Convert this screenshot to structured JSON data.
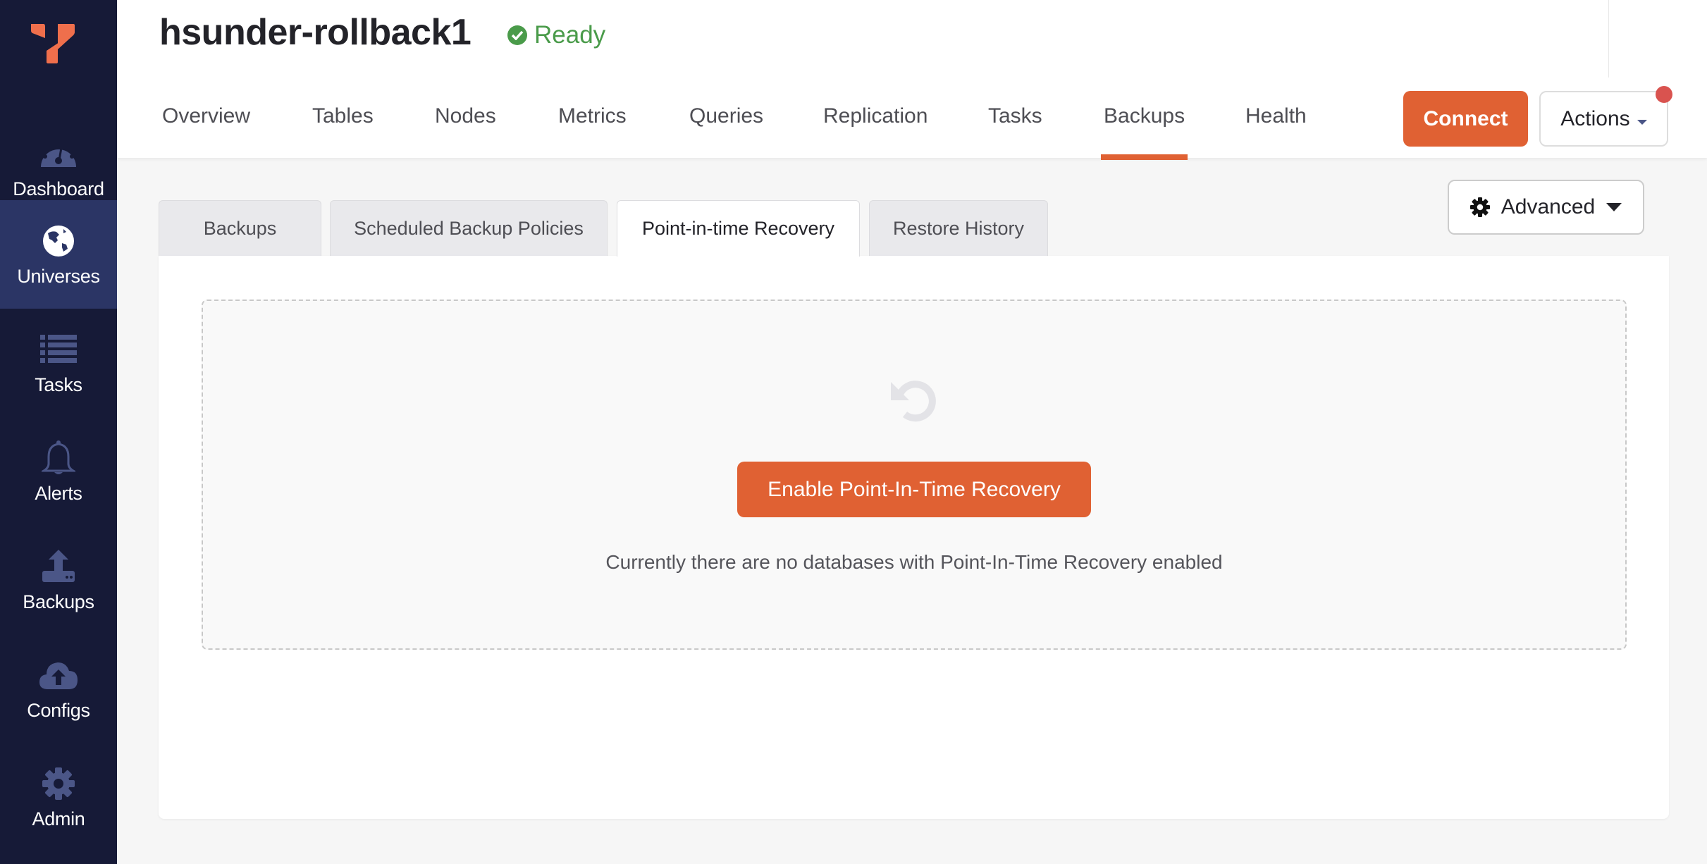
{
  "sidebar": {
    "logo": "yugabyte-logo",
    "items": [
      {
        "label": "Dashboard",
        "icon": "dashboard-gauge-icon",
        "active": false
      },
      {
        "label": "Universes",
        "icon": "globe-icon",
        "active": true
      },
      {
        "label": "Tasks",
        "icon": "list-icon",
        "active": false
      },
      {
        "label": "Alerts",
        "icon": "bell-icon",
        "active": false
      },
      {
        "label": "Backups",
        "icon": "upload-drive-icon",
        "active": false
      },
      {
        "label": "Configs",
        "icon": "cloud-upload-icon",
        "active": false
      },
      {
        "label": "Admin",
        "icon": "gear-icon",
        "active": false
      }
    ]
  },
  "header": {
    "title": "hsunder-rollback1",
    "status": "Ready",
    "status_color": "#4a9b4a",
    "tabs": [
      {
        "label": "Overview",
        "active": false
      },
      {
        "label": "Tables",
        "active": false
      },
      {
        "label": "Nodes",
        "active": false
      },
      {
        "label": "Metrics",
        "active": false
      },
      {
        "label": "Queries",
        "active": false
      },
      {
        "label": "Replication",
        "active": false
      },
      {
        "label": "Tasks",
        "active": false
      },
      {
        "label": "Backups",
        "active": true
      },
      {
        "label": "Health",
        "active": false
      }
    ],
    "connect_label": "Connect",
    "actions_label": "Actions"
  },
  "backups": {
    "advanced_label": "Advanced",
    "subtabs": [
      {
        "label": "Backups",
        "active": false
      },
      {
        "label": "Scheduled Backup Policies",
        "active": false
      },
      {
        "label": "Point-in-time Recovery",
        "active": true
      },
      {
        "label": "Restore History",
        "active": false
      }
    ],
    "empty_state": {
      "icon": "undo-icon",
      "button_label": "Enable Point-In-Time Recovery",
      "message": "Currently there are no databases with Point-In-Time Recovery enabled"
    }
  },
  "colors": {
    "accent": "#e06133",
    "sidebar_bg": "#161a37",
    "sidebar_active": "#2b3565",
    "icon_muted": "#4b5687"
  }
}
